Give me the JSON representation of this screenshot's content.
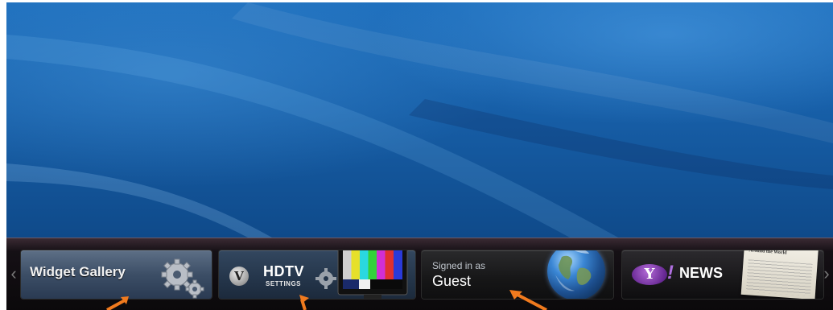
{
  "dock": {
    "tiles": [
      {
        "id": "widget-gallery",
        "label": "Widget Gallery",
        "icon": "gears-icon"
      },
      {
        "id": "hdtv-settings",
        "label": "HDTV",
        "sublabel": "SETTINGS",
        "icon": "tv-color-bars-icon",
        "brand_icon": "vizio-v-logo"
      },
      {
        "id": "signed-in",
        "caption": "Signed in as",
        "user": "Guest",
        "icon": "globe-icon"
      },
      {
        "id": "yahoo-news",
        "brand": "Y",
        "label": "NEWS",
        "icon": "newspaper-icon",
        "newspaper_headline": "Breaking News Items from Around the World"
      }
    ],
    "left_arrow": "‹",
    "right_arrow": "›"
  },
  "annotations": {
    "arrow_color": "#f07a1e",
    "arrows": [
      "callout-arrow-gallery",
      "callout-arrow-hdtv",
      "callout-arrow-signin"
    ]
  },
  "colors": {
    "wallpaper": "#175fa8",
    "dock_background": "#0b090b",
    "yahoo_purple": "#6a2a96"
  }
}
